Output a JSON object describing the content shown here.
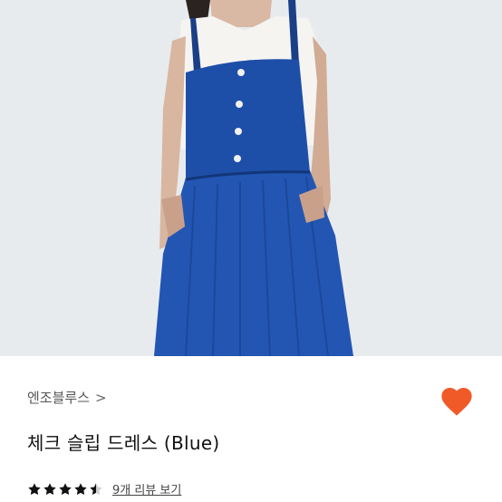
{
  "product": {
    "brand": "엔조블루스",
    "brand_chevron": ">",
    "title": "체크 슬립 드레스 (Blue)",
    "rating": 4.5,
    "review_link": "9개 리뷰 보기",
    "favorited": true
  },
  "colors": {
    "heart": "#f05a28",
    "dress": "#1e4fa8",
    "photo_bg": "#e8ebee"
  },
  "icons": {
    "favorite": "heart-icon",
    "brand_link": "chevron-right-icon",
    "rating": "star-icon"
  }
}
